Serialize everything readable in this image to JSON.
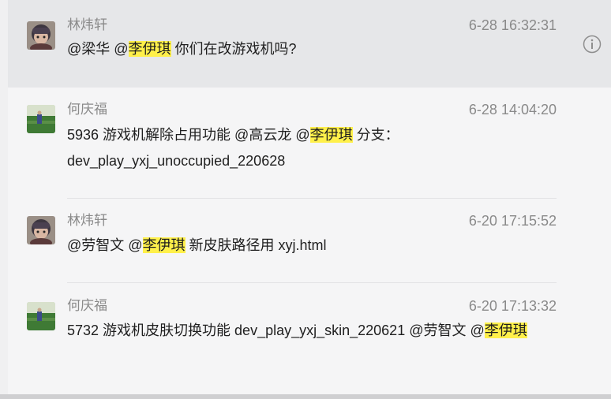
{
  "messages": [
    {
      "sender": "林炜轩",
      "time": "6-28 16:32:31",
      "content": [
        {
          "text": "@梁华 @",
          "hl": false
        },
        {
          "text": "李伊琪",
          "hl": true
        },
        {
          "text": " 你们在改游戏机吗?",
          "hl": false
        }
      ]
    },
    {
      "sender": "何庆福",
      "time": "6-28 14:04:20",
      "content": [
        {
          "text": "5936 游戏机解除占用功能 @高云龙 @",
          "hl": false
        },
        {
          "text": "李伊琪",
          "hl": true
        },
        {
          "text": " 分支： dev_play_yxj_unoccupied_220628",
          "hl": false
        }
      ]
    },
    {
      "sender": "林炜轩",
      "time": "6-20 17:15:52",
      "content": [
        {
          "text": "@劳智文 @",
          "hl": false
        },
        {
          "text": "李伊琪",
          "hl": true
        },
        {
          "text": " 新皮肤路径用 xyj.html",
          "hl": false
        }
      ]
    },
    {
      "sender": "何庆福",
      "time": "6-20 17:13:32",
      "content": [
        {
          "text": "5732 游戏机皮肤切换功能 dev_play_yxj_skin_220621 @劳智文 @",
          "hl": false
        },
        {
          "text": "李伊琪",
          "hl": true
        }
      ]
    }
  ],
  "colors": {
    "highlight": "#fff04a",
    "hover_row": "#e6e7e9",
    "meta_text": "#8a8a8a"
  },
  "icons": {
    "info": "info-icon"
  }
}
